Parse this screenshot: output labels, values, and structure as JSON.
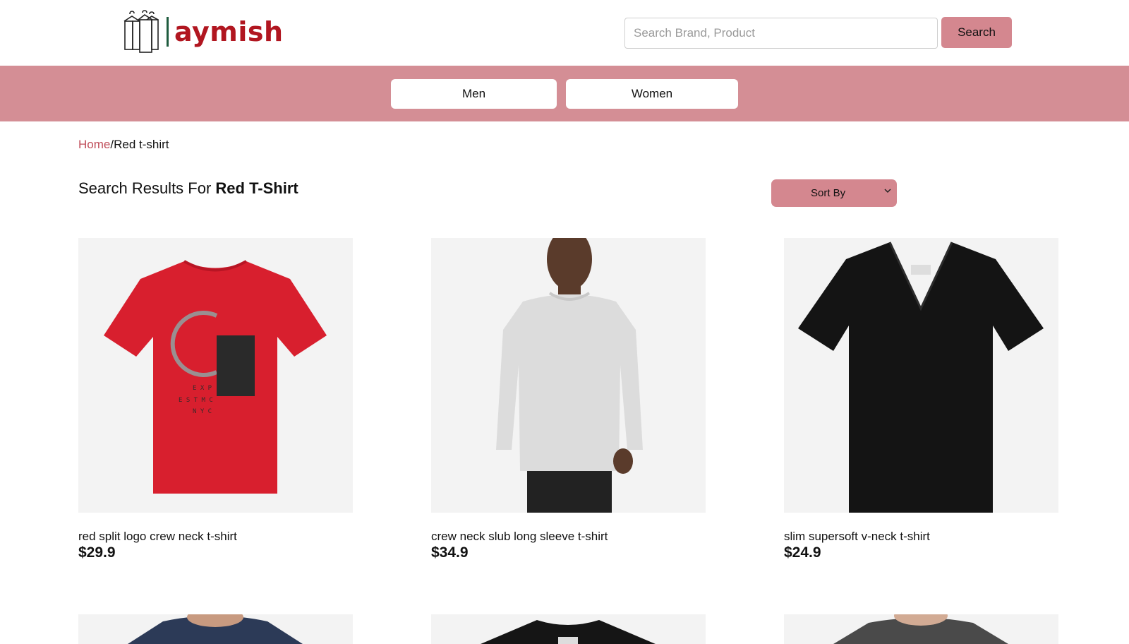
{
  "brand": {
    "logo_text": "aymish",
    "logo_icon": "clothes-hanger-icon"
  },
  "search": {
    "placeholder": "Search Brand, Product",
    "value": "",
    "button_label": "Search"
  },
  "nav": {
    "items": [
      {
        "label": "Men"
      },
      {
        "label": "Women"
      }
    ]
  },
  "breadcrumb": {
    "home": "Home",
    "separator": "/",
    "current": "Red t-shirt"
  },
  "results": {
    "prefix": "Search Results For ",
    "query": "Red T-Shirt"
  },
  "sort": {
    "label": "Sort By",
    "icon": "chevron-down-icon"
  },
  "products": [
    {
      "name": "red split logo crew neck t-shirt",
      "price": "$29.9",
      "image": "red-tshirt"
    },
    {
      "name": "crew neck slub long sleeve t-shirt",
      "price": "$34.9",
      "image": "grey-longsleeve-model"
    },
    {
      "name": "slim supersoft v-neck t-shirt",
      "price": "$24.9",
      "image": "black-vneck-tshirt"
    },
    {
      "name": "",
      "price": "",
      "image": "navy-tshirt-model"
    },
    {
      "name": "",
      "price": "",
      "image": "black-tshirt"
    },
    {
      "name": "",
      "price": "",
      "image": "grey-tshirt-model"
    }
  ],
  "colors": {
    "accent": "#d48e95",
    "brand_red": "#b11620",
    "link": "#c04d59"
  }
}
